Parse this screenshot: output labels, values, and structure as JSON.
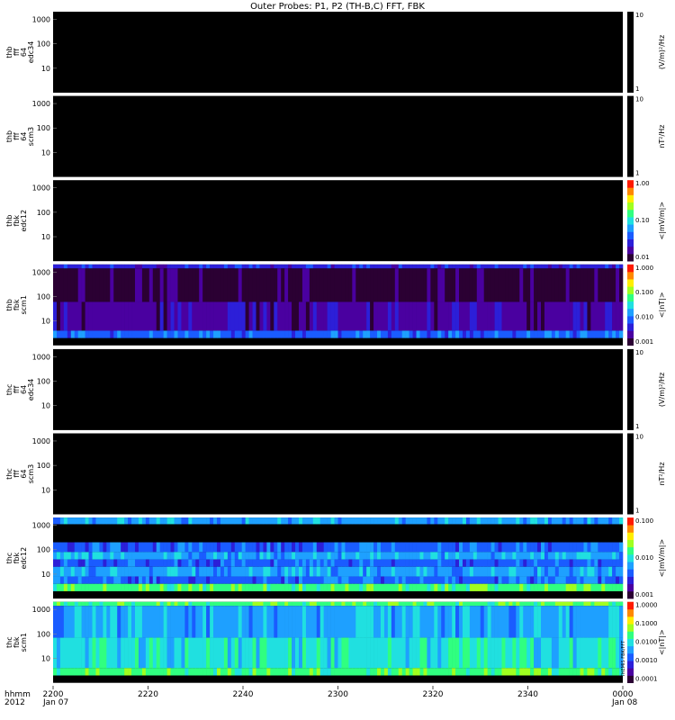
{
  "title": "Outer Probes: P1, P2 (TH-B,C) FFT, FBK",
  "colors": {
    "background": "#ffffff",
    "panel_bg": "#000000",
    "separator": "#ffffff",
    "colormap": [
      "#2b0033",
      "#4a00a0",
      "#2c1fd8",
      "#1a5cff",
      "#1ea0ff",
      "#20e0e0",
      "#30ff80",
      "#a0ff20",
      "#ffee00",
      "#ff8800",
      "#ff1a00"
    ]
  },
  "chart_data": [
    {
      "type": "heatmap",
      "ylabel": [
        "thb",
        "fff",
        "64",
        "edc34"
      ],
      "yticks": [
        "1000",
        "100",
        "10"
      ],
      "colorbar_label": "(V/m)²/Hz",
      "colorbar_ticks": [
        "10",
        "1"
      ],
      "colorbar_gradient": false,
      "fill": "black"
    },
    {
      "type": "heatmap",
      "ylabel": [
        "thb",
        "fff",
        "64",
        "scm3"
      ],
      "yticks": [
        "1000",
        "100",
        "10"
      ],
      "colorbar_label": "nT²/Hz",
      "colorbar_ticks": [
        "10",
        "1"
      ],
      "colorbar_gradient": false,
      "fill": "black"
    },
    {
      "type": "heatmap",
      "ylabel": [
        "thb",
        "fbk",
        "edc12"
      ],
      "yticks": [
        "1000",
        "100",
        "10"
      ],
      "colorbar_label": "<|mV/m|>",
      "colorbar_ticks": [
        "1.00",
        "0.10",
        "0.01"
      ],
      "colorbar_gradient": true,
      "fill": "black"
    },
    {
      "type": "heatmap",
      "ylabel": [
        "thb",
        "fbk",
        "scm1"
      ],
      "yticks": [
        "1000",
        "100",
        "10"
      ],
      "colorbar_label": "<|nT|>",
      "colorbar_ticks": [
        "1.000",
        "0.100",
        "0.010",
        "0.001"
      ],
      "colorbar_gradient": true,
      "fill": "data",
      "bands": [
        {
          "f_top": 2048,
          "f_bottom": 1400,
          "level": 2
        },
        {
          "f_top": 1400,
          "f_bottom": 60,
          "level": 0
        },
        {
          "f_top": 60,
          "f_bottom": 4,
          "level": 1
        },
        {
          "f_top": 4,
          "f_bottom": 2,
          "level": 3
        }
      ]
    },
    {
      "type": "heatmap",
      "ylabel": [
        "thc",
        "fff",
        "64",
        "edc34"
      ],
      "yticks": [
        "1000",
        "100",
        "10"
      ],
      "colorbar_label": "(V/m)²/Hz",
      "colorbar_ticks": [
        "10",
        "1"
      ],
      "colorbar_gradient": false,
      "fill": "black"
    },
    {
      "type": "heatmap",
      "ylabel": [
        "thc",
        "fff",
        "64",
        "scm3"
      ],
      "yticks": [
        "1000",
        "100",
        "10"
      ],
      "colorbar_label": "nT²/Hz",
      "colorbar_ticks": [
        "10",
        "1"
      ],
      "colorbar_gradient": false,
      "fill": "black"
    },
    {
      "type": "heatmap",
      "ylabel": [
        "thc",
        "fbk",
        "edc12"
      ],
      "yticks": [
        "1000",
        "100",
        "10"
      ],
      "colorbar_label": "<|mV/m|>",
      "colorbar_ticks": [
        "0.100",
        "0.010",
        "0.001"
      ],
      "colorbar_gradient": true,
      "fill": "data",
      "bands": [
        {
          "f_top": 2048,
          "f_bottom": 1100,
          "level": 4
        },
        {
          "f_top": 1100,
          "f_bottom": 200,
          "level": -1
        },
        {
          "f_top": 200,
          "f_bottom": 80,
          "level": 3
        },
        {
          "f_top": 80,
          "f_bottom": 40,
          "level": 4
        },
        {
          "f_top": 40,
          "f_bottom": 20,
          "level": 3
        },
        {
          "f_top": 20,
          "f_bottom": 8,
          "level": 4
        },
        {
          "f_top": 8,
          "f_bottom": 4,
          "level": 3
        },
        {
          "f_top": 4,
          "f_bottom": 2,
          "level": 6
        }
      ]
    },
    {
      "type": "heatmap",
      "ylabel": [
        "thc",
        "fbk",
        "scm1"
      ],
      "yticks": [
        "1000",
        "100",
        "10"
      ],
      "colorbar_label": "<|nT|>",
      "colorbar_ticks": [
        "1.0000",
        "0.1000",
        "0.0100",
        "0.0010",
        "0.0001"
      ],
      "colorbar_gradient": true,
      "fill": "data",
      "bands": [
        {
          "f_top": 2048,
          "f_bottom": 1400,
          "level": 6
        },
        {
          "f_top": 1400,
          "f_bottom": 70,
          "level": 4
        },
        {
          "f_top": 70,
          "f_bottom": 4,
          "level": 5
        },
        {
          "f_top": 4,
          "f_bottom": 2,
          "level": 6
        }
      ]
    }
  ],
  "x_axis": {
    "left_label_1": "hhmm",
    "left_label_2": "2012",
    "ticks": [
      "2200",
      "2220",
      "2240",
      "2300",
      "2320",
      "2340",
      "0000"
    ],
    "date_start": "Jan 07",
    "date_end": "Jan 08"
  },
  "side_annotation": "THEMIS FBK/FFT"
}
